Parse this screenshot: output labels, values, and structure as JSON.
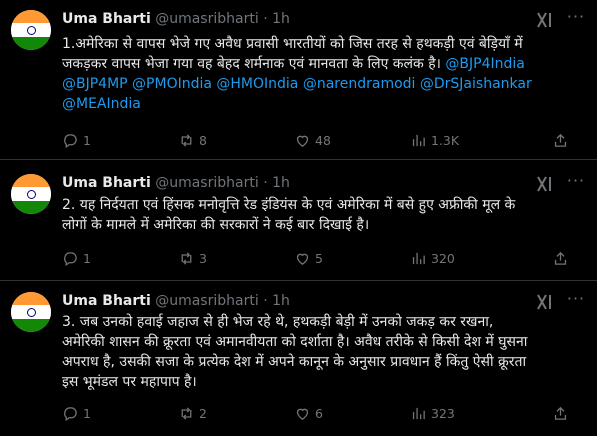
{
  "tweets": [
    {
      "author_name": "Uma Bharti",
      "handle": "@umasribharti",
      "separator": "·",
      "time": "1h",
      "text_lines": [
        "1.अमेरिका से वापस भेजे गए अवैध प्रवासी भारतीयों को जिस तरह से हथकड़ी एवं बेड़ियाँ में",
        "जकड़कर वापस भेजा गया वह बेहद शर्मनाक एवं मानवता के लिए कलंक है।"
      ],
      "mentions_inline": " @BJP4India",
      "mentions_line2": "@BJP4MP  @PMOIndia @HMOIndia @narendramodi @DrSJaishankar",
      "mentions_line3": "@MEAIndia",
      "replies": "1",
      "reposts": "8",
      "likes": "48",
      "views": "1.3K"
    },
    {
      "author_name": "Uma Bharti",
      "handle": "@umasribharti",
      "separator": "·",
      "time": "1h",
      "text_lines": [
        "2. यह निर्दयता एवं हिंसक मनोवृत्ति रेड इंडियंस के एवं अमेरिका में बसे हुए अफ्रीकी मूल के",
        "लोगों के मामले में अमेरिका की सरकारों ने कई बार दिखाई है।"
      ],
      "replies": "1",
      "reposts": "3",
      "likes": "5",
      "views": "320"
    },
    {
      "author_name": "Uma Bharti",
      "handle": "@umasribharti",
      "separator": "·",
      "time": "1h",
      "text_lines": [
        "3. जब उनको हवाई जहाज से ही भेज रहे थे, हथकड़ी बेड़ी में उनको जकड़ कर रखना,",
        "अमेरिकी शासन की क्रूरता एवं अमानवीयता को दर्शाता है। अवैध तरीके से किसी देश में घुसना",
        "अपराध है, उसकी सजा के प्रत्येक देश में अपने कानून के अनुसार प्रावधान हैं किंतु ऐसी क्रूरता",
        "इस भूमंडल पर महापाप है।"
      ],
      "replies": "1",
      "reposts": "2",
      "likes": "6",
      "views": "323"
    }
  ],
  "icons": {
    "reply": "reply-icon",
    "repost": "repost-icon",
    "like": "heart-icon",
    "views": "views-bar-chart-icon",
    "share": "share-icon",
    "grok": "grok-icon",
    "more": "more-dots-icon"
  },
  "colors": {
    "background": "#000000",
    "text": "#e7e9ea",
    "muted": "#71767b",
    "link": "#1d9bf0",
    "border": "#2f3336"
  }
}
